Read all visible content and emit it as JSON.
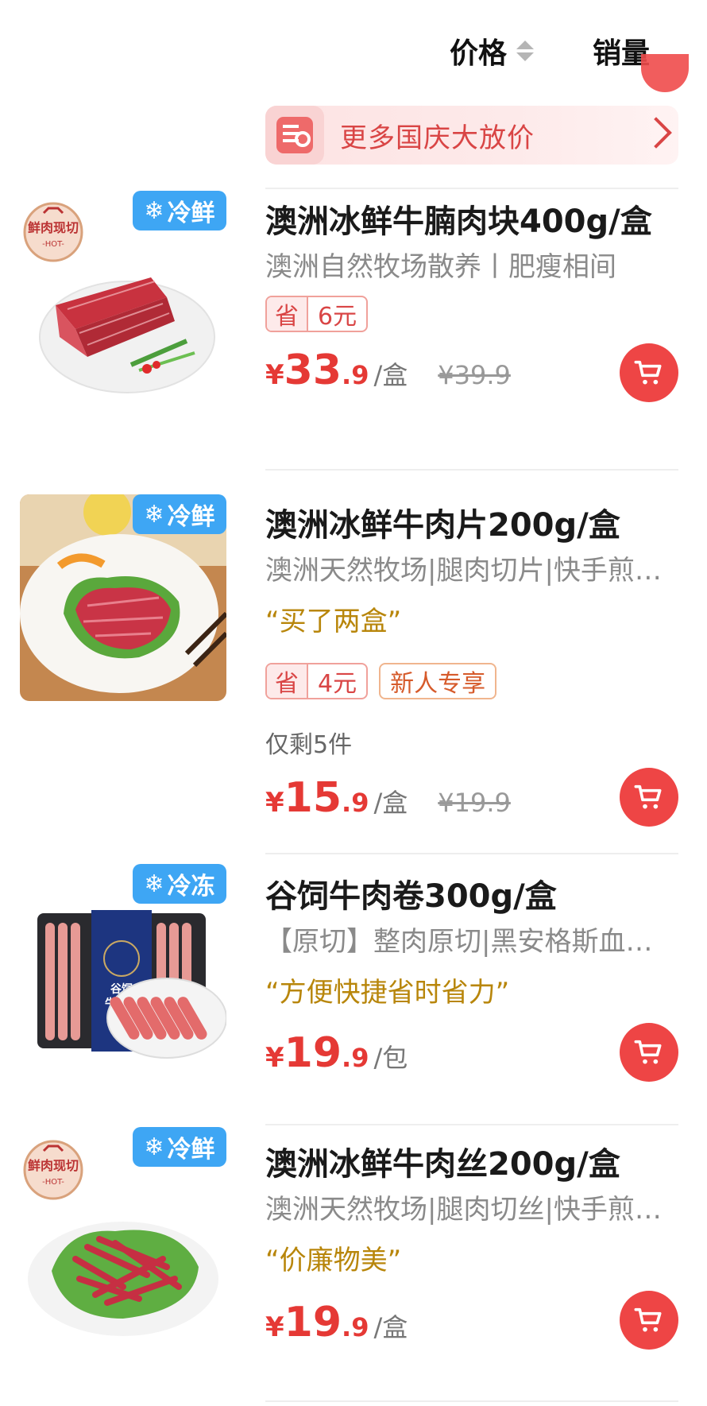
{
  "sort": {
    "price_label": "价格",
    "sales_label": "销量"
  },
  "promo": {
    "text": "更多国庆大放价",
    "icon": "search-list-icon"
  },
  "colors": {
    "price_red": "#e53935",
    "badge_blue": "#3ea6f4",
    "quote_gold": "#b8860b",
    "promo_bg": "#fde3e3"
  },
  "products": [
    {
      "title": "澳洲冰鲜牛腩肉块400g/盒",
      "subtitle": "澳洲自然牧场散养丨肥瘦相间",
      "badge": "冷鲜",
      "tag_save_key": "省",
      "tag_save_value": "6元",
      "price_symbol": "¥",
      "price_int": "33",
      "price_dec": ".9",
      "unit": "/盒",
      "original_price": "¥39.9"
    },
    {
      "title": "澳洲冰鲜牛肉片200g/盒",
      "subtitle": "澳洲天然牧场|腿肉切片|快手煎…",
      "badge": "冷鲜",
      "quote": "“买了两盒”",
      "tag_save_key": "省",
      "tag_save_value": "4元",
      "tag_extra": "新人专享",
      "stock": "仅剩5件",
      "price_symbol": "¥",
      "price_int": "15",
      "price_dec": ".9",
      "unit": "/盒",
      "original_price": "¥19.9"
    },
    {
      "title": "谷饲牛肉卷300g/盒",
      "subtitle": "【原切】整肉原切|黑安格斯血…",
      "badge": "冷冻",
      "quote": "“方便快捷省时省力”",
      "price_symbol": "¥",
      "price_int": "19",
      "price_dec": ".9",
      "unit": "/包"
    },
    {
      "title": "澳洲冰鲜牛肉丝200g/盒",
      "subtitle": "澳洲天然牧场|腿肉切丝|快手煎…",
      "badge": "冷鲜",
      "quote": "“价廉物美”",
      "price_symbol": "¥",
      "price_int": "19",
      "price_dec": ".9",
      "unit": "/盒"
    }
  ]
}
